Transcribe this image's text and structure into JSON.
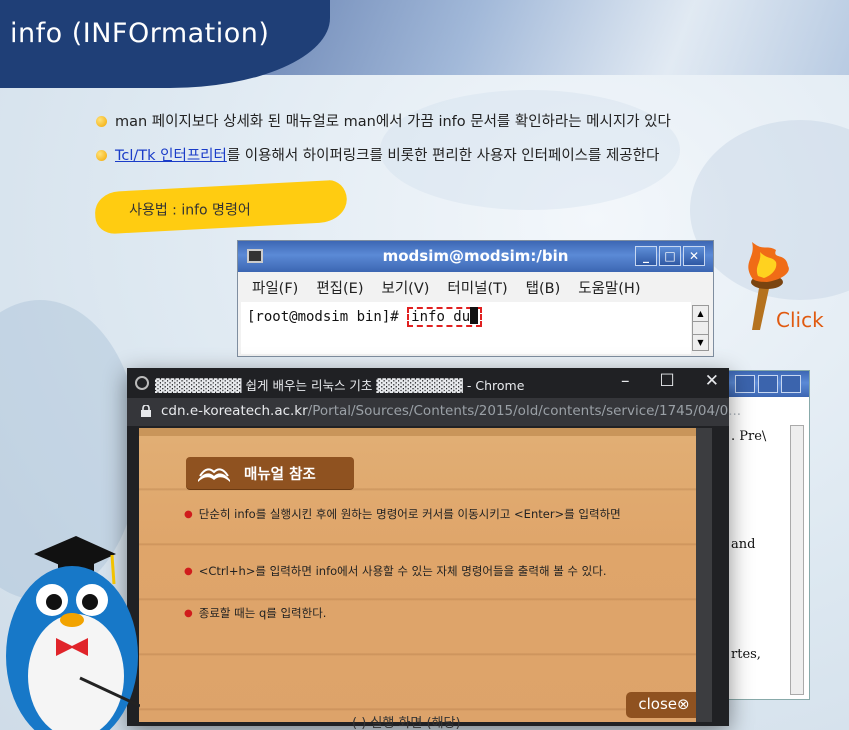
{
  "header": {
    "title": "info (INFOrmation)"
  },
  "bullets": [
    {
      "text": "man 페이지보다 상세화 된 매뉴얼로 man에서 가끔 info 문서를 확인하라는 메시지가 있다"
    },
    {
      "link": "Tcl/Tk 인터프리터",
      "text": "를 이용해서 하이퍼링크를 비롯한 편리한 사용자 인터페이스를 제공한다"
    }
  ],
  "usage_tag": "사용법 : info 명령어",
  "terminal": {
    "title": "modsim@modsim:/bin",
    "menu": [
      "파일(F)",
      "편집(E)",
      "보기(V)",
      "터미널(T)",
      "탭(B)",
      "도움말(H)"
    ],
    "prompt": "[root@modsim bin]#",
    "command": "info du"
  },
  "click_label": "Click",
  "background_terminal": {
    "line1": ".  Pre\\",
    "line2": "and",
    "line3": "rtes,"
  },
  "popup": {
    "window_title": "▓▓▓▓▓▓▓▓▓ 쉽게 배우는 리눅스 기초 ▓▓▓▓▓▓▓▓▓ - Chrome",
    "url_host": "cdn.e-koreatech.ac.kr",
    "url_path": "/Portal/Sources/Contents/2015/old/contents/service/1745/04/0...",
    "section_title": "매뉴얼 참조",
    "items": [
      "단순히 info를 실행시킨 후에 원하는 명령어로 커서를 이동시키고 <Enter>를 입력하면",
      "<Ctrl+h>를 입력하면 info에서 사용할 수 있는 자체 명령어들을 출력해 볼 수 있다.",
      "종료할 때는 q를 입력한다."
    ],
    "close_label": "close⊗"
  },
  "caption": "(       )  실행 화면 (해당)",
  "colors": {
    "header_band": "#1f3f77",
    "accent_yellow": "#ffcc11",
    "popup_board": "#dfa56a",
    "tag_brown": "#8f5220"
  }
}
